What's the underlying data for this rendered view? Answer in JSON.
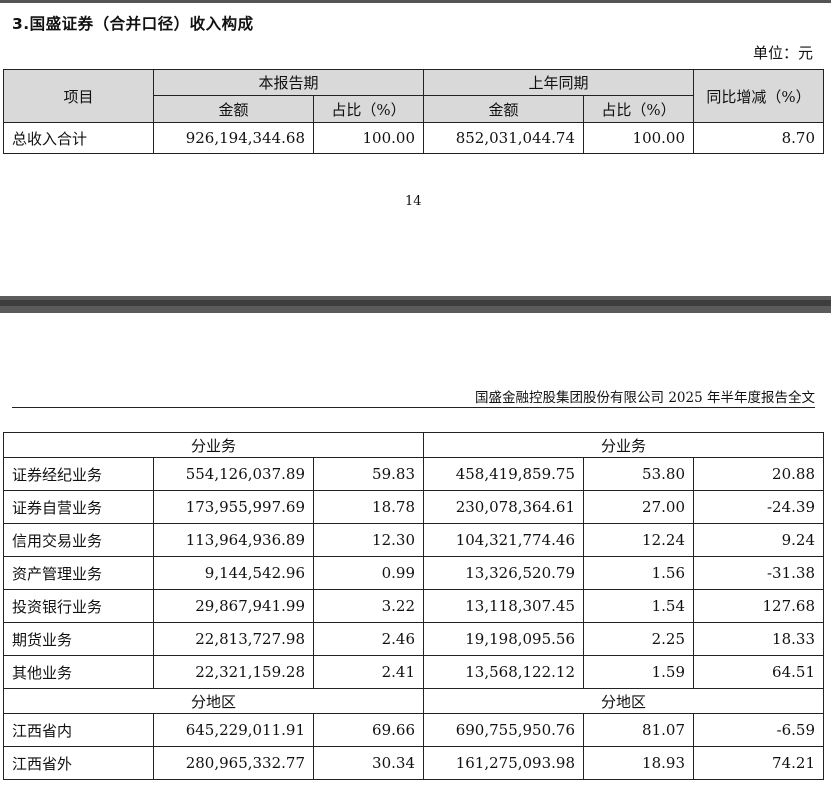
{
  "section_title": "3.国盛证券（合并口径）收入构成",
  "unit": "单位：元",
  "table1": {
    "header": {
      "item": "项目",
      "current_period": "本报告期",
      "prior_period": "上年同期",
      "yoy": "同比增减（%）",
      "amount": "金额",
      "ratio": "占比（%）"
    },
    "rows": [
      [
        "总收入合计",
        "926,194,344.68",
        "100.00",
        "852,031,044.74",
        "100.00",
        "8.70"
      ]
    ]
  },
  "page_number": "14",
  "doc_header": "国盛金融控股集团股份有限公司 2025 年半年度报告全文",
  "table2": {
    "group_business_left": "分业务",
    "group_business_right": "分业务",
    "business_rows": [
      [
        "证券经纪业务",
        "554,126,037.89",
        "59.83",
        "458,419,859.75",
        "53.80",
        "20.88"
      ],
      [
        "证券自营业务",
        "173,955,997.69",
        "18.78",
        "230,078,364.61",
        "27.00",
        "-24.39"
      ],
      [
        "信用交易业务",
        "113,964,936.89",
        "12.30",
        "104,321,774.46",
        "12.24",
        "9.24"
      ],
      [
        "资产管理业务",
        "9,144,542.96",
        "0.99",
        "13,326,520.79",
        "1.56",
        "-31.38"
      ],
      [
        "投资银行业务",
        "29,867,941.99",
        "3.22",
        "13,118,307.45",
        "1.54",
        "127.68"
      ],
      [
        "期货业务",
        "22,813,727.98",
        "2.46",
        "19,198,095.56",
        "2.25",
        "18.33"
      ],
      [
        "其他业务",
        "22,321,159.28",
        "2.41",
        "13,568,122.12",
        "1.59",
        "64.51"
      ]
    ],
    "group_region_left": "分地区",
    "group_region_right": "分地区",
    "region_rows": [
      [
        "江西省内",
        "645,229,011.91",
        "69.66",
        "690,755,950.76",
        "81.07",
        "-6.59"
      ],
      [
        "江西省外",
        "280,965,332.77",
        "30.34",
        "161,275,093.98",
        "18.93",
        "74.21"
      ]
    ]
  }
}
